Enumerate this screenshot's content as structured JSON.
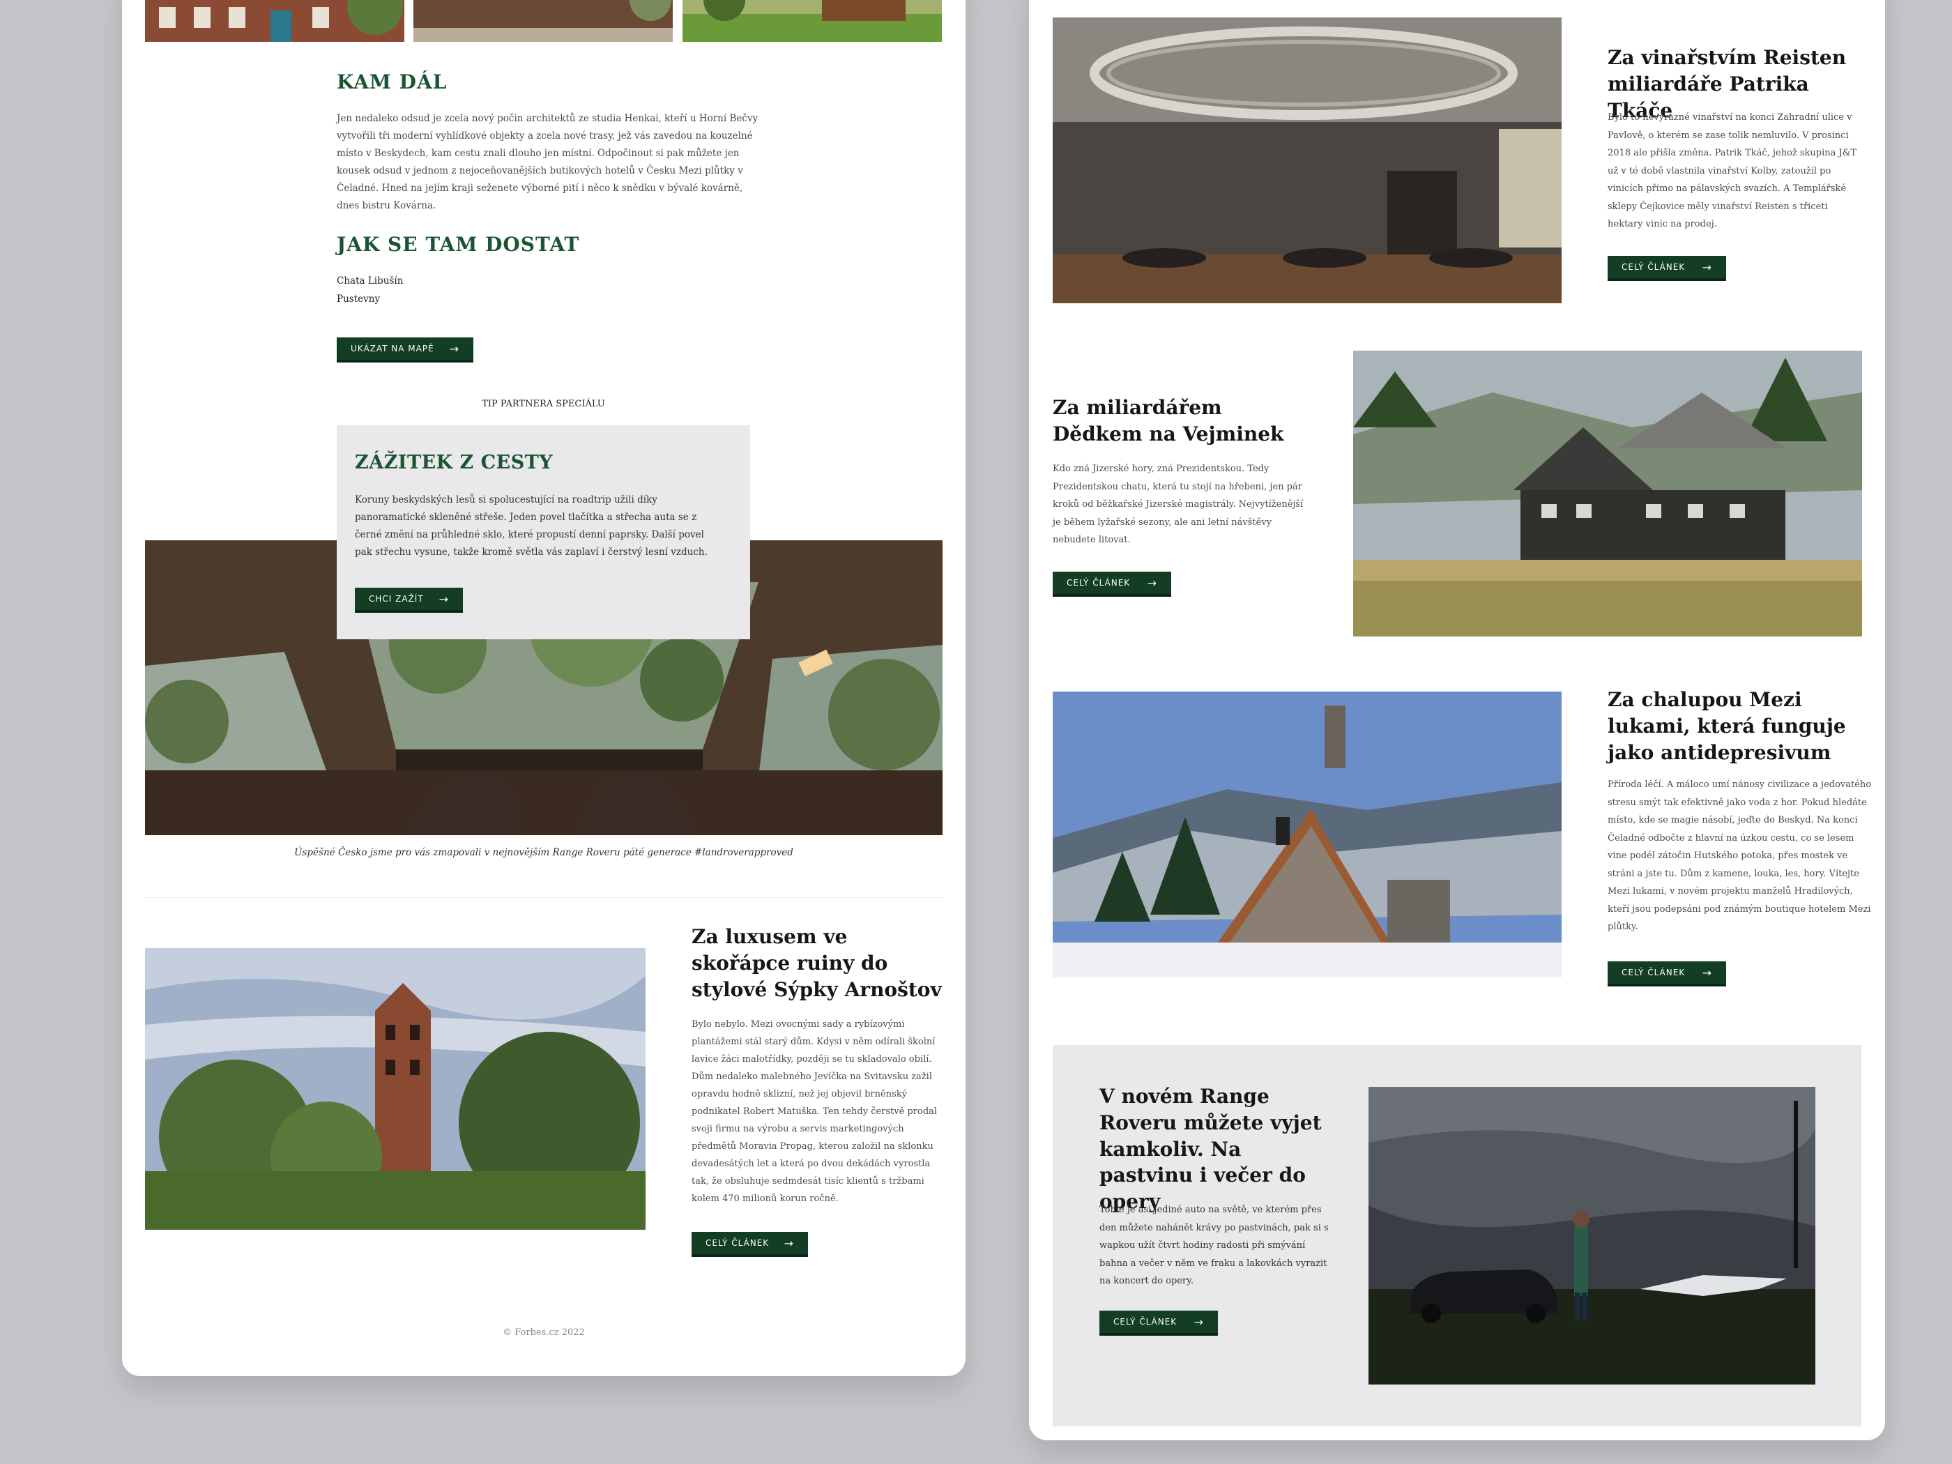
{
  "kam_dal": {
    "title": "KAM DÁL",
    "text": "Jen nedaleko odsud je zcela nový počin architektů ze studia Henkai, kteří u Horní Bečvy vytvořili tři moderní vyhlídkové objekty a zcela nové trasy, jež vás zavedou na kouzelné místo v Beskydech, kam cestu znali dlouho jen místní. Odpočinout si pak můžete jen kousek odsud v jednom z nejoceňovanějších butikových hotelů v Česku Mezi plůtky v Čeladné. Hned na jejím kraji seženete výborné pití i něco k snědku v bývalé kovárně, dnes bistru Kovárna."
  },
  "jak_se_tam_dostat": {
    "title": "JAK SE TAM DOSTAT",
    "line1": "Chata Libušín",
    "line2": "Pustevny",
    "button": "UKÁZAT NA MAPĚ"
  },
  "partner": {
    "label": "TIP PARTNERA SPECIÁLU",
    "title": "ZÁŽITEK Z CESTY",
    "text": "Koruny beskydských lesů si spolucestující na roadtrip užili díky panoramatické skleněné střeše. Jeden povel tlačítka a střecha auta se z černé změní na průhledné sklo, které propustí denní paprsky. Další povel pak střechu vysune, takže kromě světla vás zaplaví i čerstvý lesní vzduch.",
    "button": "CHCI ZAŽÍT",
    "caption": "Úspěšné Česko jsme pro vás zmapovali v nejnovějším Range Roveru páté generace #landroverapproved"
  },
  "left_article": {
    "title": "Za luxusem ve skořápce ruiny do stylové Sýpky Arnoštov",
    "text": "Bylo nebylo. Mezi ovocnými sady a rybízovými plantážemi stál starý dům. Kdysi v něm odírali školní lavice žáci malotřídky, později se tu skladovalo obilí. Dům nedaleko malebného Jevíčka na Svitavsku zažil opravdu hodně sklizní, než jej objevil brněnský podnikatel Robert Matuška. Ten tehdy čerstvě prodal svoji firmu na výrobu a servis marketingových předmětů Moravia Propag, kterou založil na sklonku devadesátých let a která po dvou dekádách vyrostla tak, že obsluhuje sedmdesát tisíc klientů s tržbami kolem 470 milionů korun ročně.",
    "button": "CELÝ ČLÁNEK"
  },
  "footer": {
    "copyright": "© Forbes.cz 2022"
  },
  "right_articles": [
    {
      "title": "Za vinařstvím Reisten miliardáře Patrika Tkáče",
      "text": "Bylo to nevýrazné vinařství na konci Zahradní ulice v Pavlově, o kterém se zase tolik nemluvilo. V prosinci 2018 ale přišla změna. Patrik Tkáč, jehož skupina J&T už v té době vlastnila vinařství Kolby, zatoužil po vinicích přímo na pálavských svazích. A Templářské sklepy Čejkovice měly vinařství Reisten s třiceti hektary vinic na prodej.",
      "button": "CELÝ ČLÁNEK"
    },
    {
      "title": "Za miliardářem Dědkem na Vejminek",
      "text": "Kdo zná Jizerské hory, zná Prezidentskou. Tedy Prezidentskou chatu, která tu stojí na hřebeni, jen pár kroků od běžkařské Jizerské magistrály. Nejvytíženější je během lyžařské sezony, ale ani letní návštěvy nebudete litovat.",
      "button": "CELÝ ČLÁNEK"
    },
    {
      "title": "Za chalupou Mezi lukami, která funguje jako antidepresivum",
      "text": "Příroda léčí. A máloco umí nánosy civilizace a jedovatého stresu smýt tak efektivně jako voda z hor. Pokud hledáte místo, kde se magie násobí, jeďte do Beskyd. Na konci Čeladné odbočte z hlavní na úzkou cestu, co se lesem vine podél zátočin Hutského potoka, přes mostek ve stráni a jste tu. Dům z kamene, louka, les, hory. Vítejte Mezi lukami, v novém projektu manželů Hradilových, kteří jsou podepsáni pod známým boutique hotelem Mezi plůtky.",
      "button": "CELÝ ČLÁNEK"
    }
  ],
  "promo": {
    "title": "V novém Range Roveru můžete vyjet kamkoliv. Na pastvinu i večer do opery",
    "text": "Tohle je asi jediné auto na světě, ve kterém přes den můžete nahánět krávy po pastvinách, pak si s wapkou užít čtvrt hodiny radosti při smývání bahna a večer v něm ve fraku a lakovkách vyrazit na koncert do opery.",
    "button": "CELÝ ČLÁNEK"
  },
  "colors": {
    "accent_green": "#1a5431",
    "button_dark_green": "#133d24",
    "grey_box": "#e9e8ea",
    "page_bg": "#c5c4c8"
  }
}
